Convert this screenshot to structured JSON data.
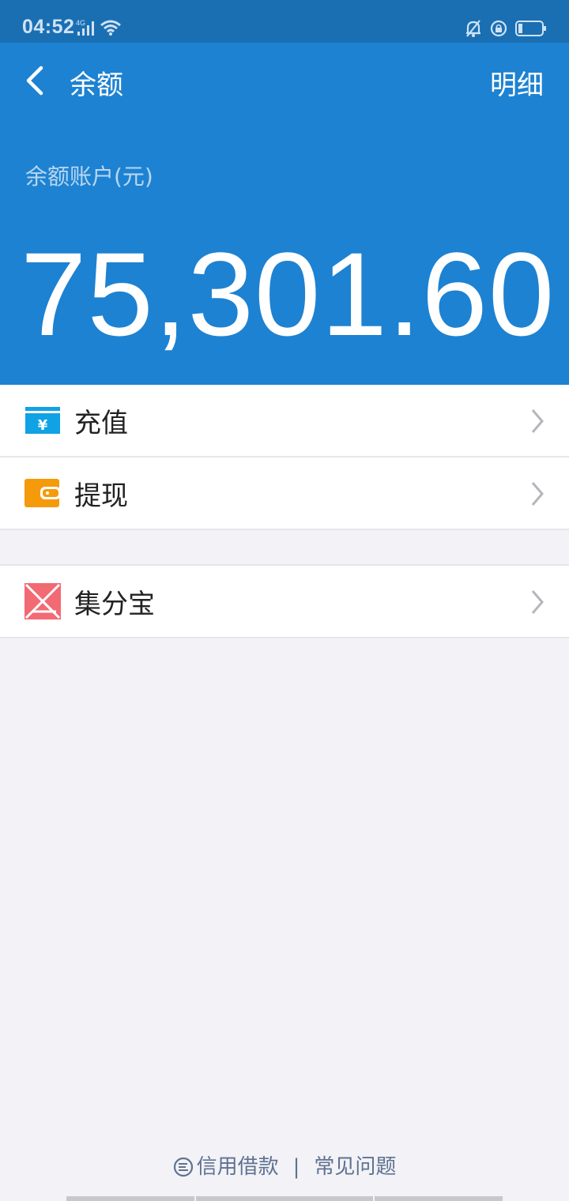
{
  "status_bar": {
    "time": "04:52",
    "network": "4G"
  },
  "header": {
    "title": "余额",
    "detail_label": "明细",
    "balance_label": "余额账户(元)",
    "balance_amount": "75,301.60"
  },
  "menu": {
    "items": [
      {
        "label": "充值",
        "icon": "recharge-icon",
        "color": "#10a2e4"
      },
      {
        "label": "提现",
        "icon": "withdraw-wallet-icon",
        "color": "#f59a0b"
      }
    ],
    "items2": [
      {
        "label": "集分宝",
        "icon": "jifenbao-icon",
        "color": "#f26a74"
      }
    ]
  },
  "footer": {
    "link1": "信用借款",
    "separator": "|",
    "link2": "常见问题"
  },
  "colors": {
    "header_bg": "#1d82d2",
    "status_bg": "#1a6fb3",
    "page_bg": "#f2f2f7"
  }
}
